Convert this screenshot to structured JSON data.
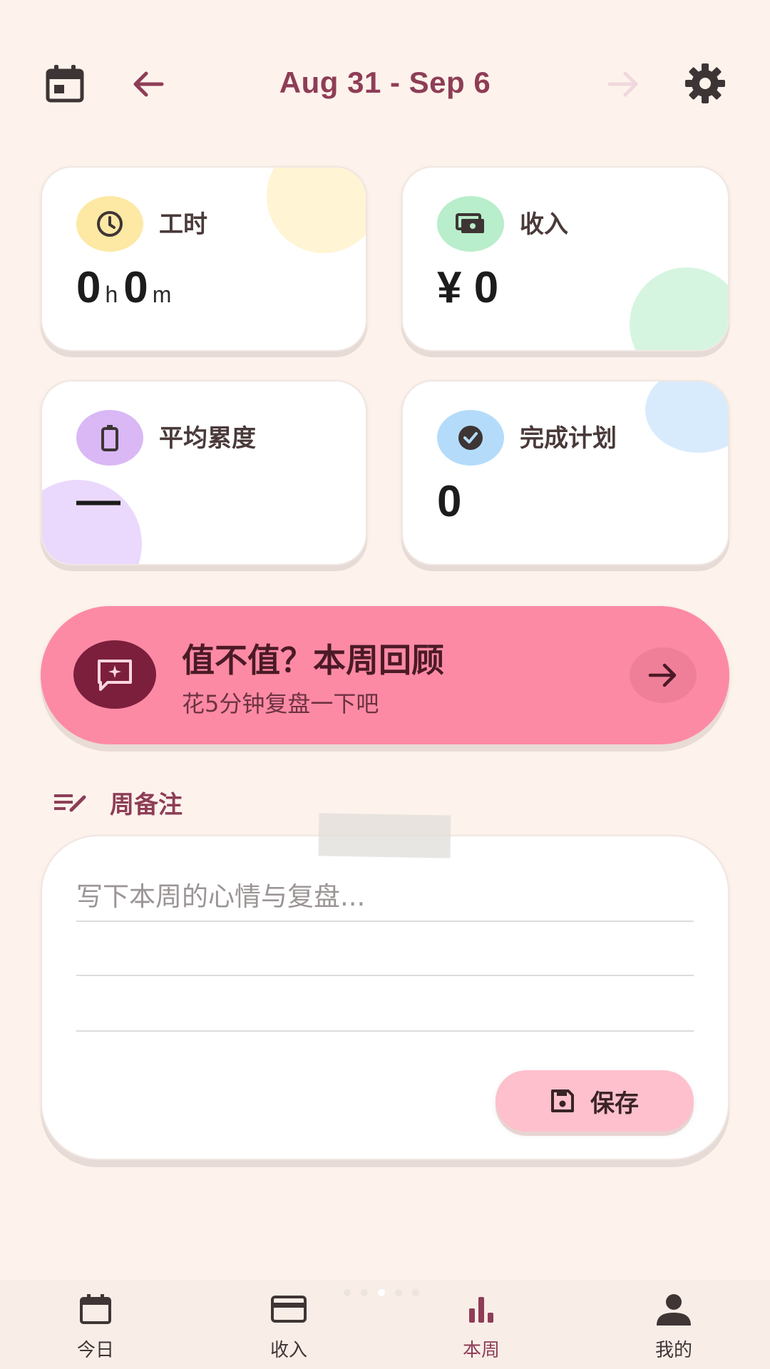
{
  "header": {
    "date_range": "Aug 31 - Sep 6",
    "icons": {
      "calendar": "calendar-icon",
      "prev": "arrow-left-icon",
      "next": "arrow-right-icon",
      "settings": "gear-icon"
    }
  },
  "stats": {
    "hours": {
      "label": "工时",
      "hours_value": "0",
      "hours_unit": "h",
      "minutes_value": "0",
      "minutes_unit": "m",
      "icon": "clock-icon"
    },
    "income": {
      "label": "收入",
      "value": "¥ 0",
      "icon": "money-icon"
    },
    "fatigue": {
      "label": "平均累度",
      "value": "—",
      "icon": "battery-icon"
    },
    "plans": {
      "label": "完成计划",
      "value": "0",
      "icon": "check-circle-icon"
    }
  },
  "review_banner": {
    "title": "值不值？本周回顾",
    "subtitle": "花5分钟复盘一下吧",
    "icon": "chat-sparkle-icon"
  },
  "notes": {
    "title": "周备注",
    "placeholder": "写下本周的心情与复盘...",
    "value": "",
    "save_label": "保存"
  },
  "bottom_nav": [
    {
      "label": "今日",
      "icon": "calendar-icon",
      "active": false
    },
    {
      "label": "收入",
      "icon": "card-icon",
      "active": false
    },
    {
      "label": "本周",
      "icon": "bar-chart-icon",
      "active": true
    },
    {
      "label": "我的",
      "icon": "person-icon",
      "active": false
    }
  ],
  "colors": {
    "background": "#fdf3ec",
    "accent": "#8e3d57",
    "banner": "#fd8aa5",
    "save_button": "#fdc0cc"
  }
}
